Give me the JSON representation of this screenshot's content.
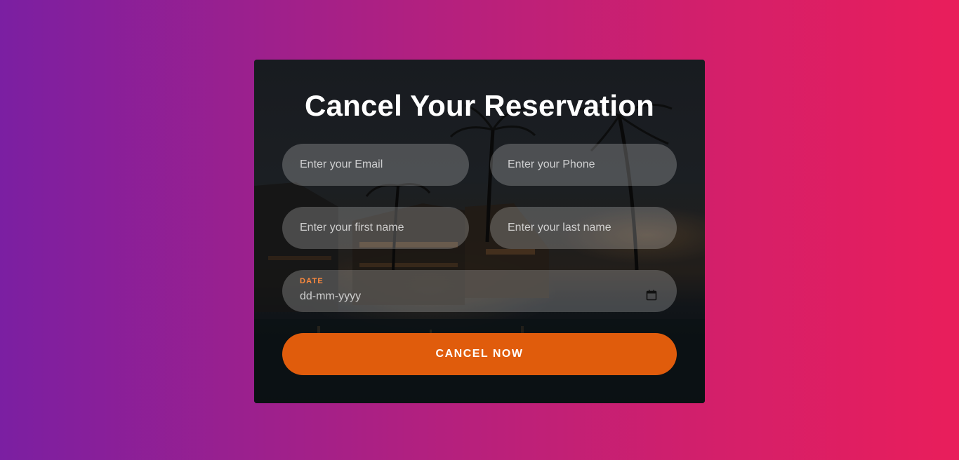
{
  "form": {
    "title": "Cancel Your Reservation",
    "email_placeholder": "Enter your Email",
    "phone_placeholder": "Enter your Phone",
    "first_name_placeholder": "Enter your first name",
    "last_name_placeholder": "Enter your last name",
    "date_label": "DATE",
    "date_placeholder": "dd-mm-yyyy",
    "submit_label": "CANCEL NOW"
  },
  "icons": {
    "calendar": "calendar-icon"
  },
  "colors": {
    "accent": "#e05c0c",
    "date_label": "#ff8a3d",
    "gradient_start": "#7b1fa2",
    "gradient_end": "#e91e5b"
  }
}
